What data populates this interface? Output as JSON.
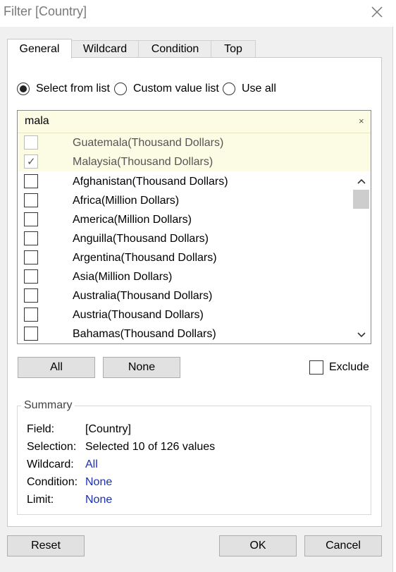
{
  "window": {
    "title": "Filter [Country]"
  },
  "tabs": [
    "General",
    "Wildcard",
    "Condition",
    "Top"
  ],
  "radio": {
    "selected": "Select from list",
    "options": [
      "Select from list",
      "Custom value list",
      "Use all"
    ]
  },
  "search": {
    "value": "mala",
    "clear_glyph": "×"
  },
  "matches": [
    {
      "label": "Guatemala(Thousand Dollars)",
      "checked": false
    },
    {
      "label": "Malaysia(Thousand Dollars)",
      "checked": true
    }
  ],
  "items": [
    {
      "label": "Afghanistan(Thousand Dollars)",
      "checked": false
    },
    {
      "label": "Africa(Million Dollars)",
      "checked": false
    },
    {
      "label": "America(Million Dollars)",
      "checked": false
    },
    {
      "label": "Anguilla(Thousand Dollars)",
      "checked": false
    },
    {
      "label": "Argentina(Thousand Dollars)",
      "checked": false
    },
    {
      "label": "Asia(Million Dollars)",
      "checked": false
    },
    {
      "label": "Australia(Thousand Dollars)",
      "checked": false
    },
    {
      "label": "Austria(Thousand Dollars)",
      "checked": false
    },
    {
      "label": "Bahamas(Thousand Dollars)",
      "checked": false
    }
  ],
  "buttons": {
    "all": "All",
    "none": "None",
    "reset": "Reset",
    "ok": "OK",
    "cancel": "Cancel"
  },
  "exclude": {
    "label": "Exclude",
    "checked": false
  },
  "summary": {
    "legend": "Summary",
    "field_label": "Field:",
    "field_value": "[Country]",
    "selection_label": "Selection:",
    "selection_value": "Selected 10 of 126 values",
    "wildcard_label": "Wildcard:",
    "wildcard_value": "All",
    "condition_label": "Condition:",
    "condition_value": "None",
    "limit_label": "Limit:",
    "limit_value": "None"
  },
  "colors": {
    "match_highlight": "#fcfbe3",
    "link": "#1a2fb3",
    "title_text": "#7a7a7a"
  }
}
